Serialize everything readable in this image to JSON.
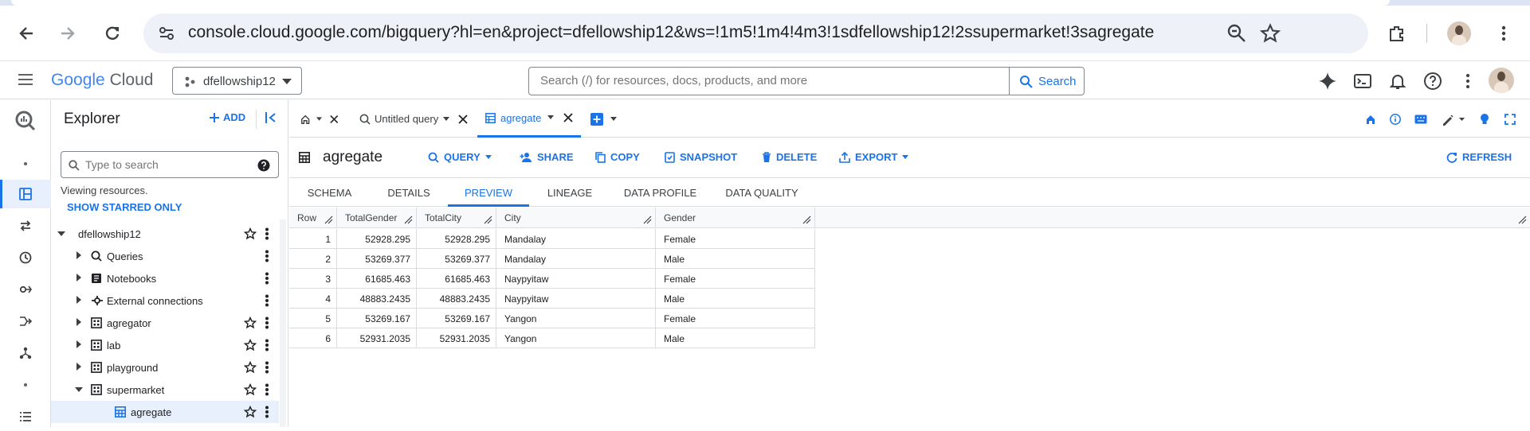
{
  "browser": {
    "url": "console.cloud.google.com/bigquery?hl=en&project=dfellowship12&ws=!1m5!1m4!4m3!1sdfellowship12!2ssupermarket!3sagregate"
  },
  "gcp": {
    "logo_google": "Google",
    "logo_cloud": "Cloud",
    "project": "dfellowship12",
    "search_placeholder": "Search (/) for resources, docs, products, and more",
    "search_button": "Search"
  },
  "explorer": {
    "title": "Explorer",
    "add_label": "ADD",
    "search_placeholder": "Type to search",
    "viewing": "Viewing resources.",
    "show_starred": "SHOW STARRED ONLY",
    "tree": [
      {
        "label": "dfellowship12",
        "level": 0,
        "icon": "project",
        "expanded": true,
        "starred_icon": true
      },
      {
        "label": "Queries",
        "level": 1,
        "icon": "queries-icon",
        "expanded": false,
        "starred_icon": false
      },
      {
        "label": "Notebooks",
        "level": 1,
        "icon": "notebook-icon",
        "expanded": false,
        "starred_icon": false
      },
      {
        "label": "External connections",
        "level": 1,
        "icon": "connection-icon",
        "expanded": false,
        "starred_icon": false
      },
      {
        "label": "agregator",
        "level": 1,
        "icon": "dataset-icon",
        "expanded": false,
        "starred_icon": true
      },
      {
        "label": "lab",
        "level": 1,
        "icon": "dataset-icon",
        "expanded": false,
        "starred_icon": true
      },
      {
        "label": "playground",
        "level": 1,
        "icon": "dataset-icon",
        "expanded": false,
        "starred_icon": true
      },
      {
        "label": "supermarket",
        "level": 1,
        "icon": "dataset-icon",
        "expanded": true,
        "starred_icon": true
      },
      {
        "label": "agregate",
        "level": 2,
        "icon": "table-icon",
        "expanded": false,
        "starred_icon": true,
        "selected": true
      }
    ]
  },
  "tabs": [
    {
      "label": "",
      "icon": "home-icon"
    },
    {
      "label": "Untitled query",
      "icon": "query-icon"
    },
    {
      "label": "agregate",
      "icon": "table-icon",
      "active": true
    }
  ],
  "toolbar": {
    "table_name": "agregate",
    "query": "QUERY",
    "share": "SHARE",
    "copy": "COPY",
    "snapshot": "SNAPSHOT",
    "delete": "DELETE",
    "export": "EXPORT",
    "refresh": "REFRESH"
  },
  "subtabs": [
    "SCHEMA",
    "DETAILS",
    "PREVIEW",
    "LINEAGE",
    "DATA PROFILE",
    "DATA QUALITY"
  ],
  "active_subtab": "PREVIEW",
  "grid": {
    "columns": [
      "Row",
      "TotalGender",
      "TotalCity",
      "City",
      "Gender"
    ],
    "rows": [
      [
        "1",
        "52928.295",
        "52928.295",
        "Mandalay",
        "Female"
      ],
      [
        "2",
        "53269.377",
        "53269.377",
        "Mandalay",
        "Male"
      ],
      [
        "3",
        "61685.463",
        "61685.463",
        "Naypyitaw",
        "Female"
      ],
      [
        "4",
        "48883.2435",
        "48883.2435",
        "Naypyitaw",
        "Male"
      ],
      [
        "5",
        "53269.167",
        "53269.167",
        "Yangon",
        "Female"
      ],
      [
        "6",
        "52931.2035",
        "52931.2035",
        "Yangon",
        "Male"
      ]
    ]
  },
  "colors": {
    "accent": "#1a73e8",
    "selected_bg": "#e8f0fe"
  }
}
